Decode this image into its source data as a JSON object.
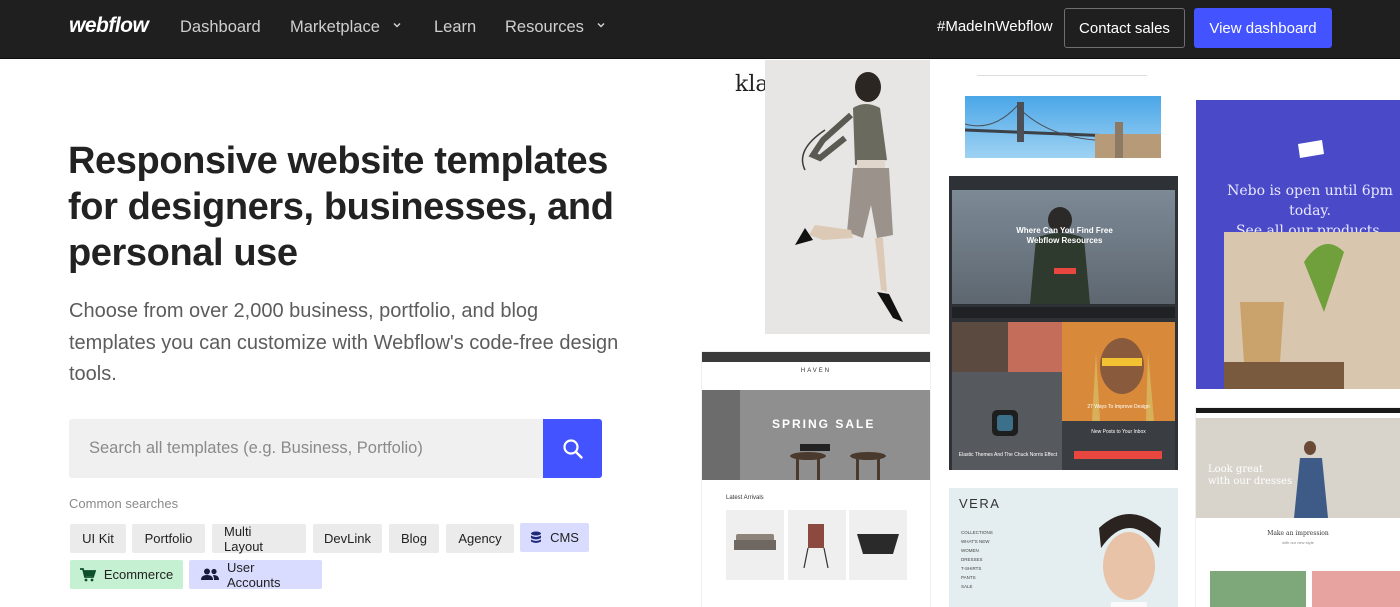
{
  "nav": {
    "logo": "webflow",
    "links": [
      {
        "label": "Dashboard",
        "has_dropdown": false
      },
      {
        "label": "Marketplace",
        "has_dropdown": true
      },
      {
        "label": "Learn",
        "has_dropdown": false
      },
      {
        "label": "Resources",
        "has_dropdown": true
      }
    ],
    "made_in": "#MadeInWebflow",
    "contact_label": "Contact sales",
    "dashboard_label": "View dashboard"
  },
  "hero": {
    "title": "Responsive website templates for designers, businesses, and personal use",
    "subtitle": "Choose from over 2,000 business, portfolio, and blog templates you can customize with Webflow's code-free design tools."
  },
  "search": {
    "placeholder": "Search all templates (e.g. Business, Portfolio)",
    "icon": "search-icon"
  },
  "common": {
    "label": "Common searches",
    "chips": [
      {
        "label": "UI Kit"
      },
      {
        "label": "Portfolio"
      },
      {
        "label": "Multi Layout"
      },
      {
        "label": "DevLink"
      },
      {
        "label": "Blog"
      },
      {
        "label": "Agency"
      },
      {
        "label": "CMS",
        "icon": "database-icon"
      },
      {
        "label": "Ecommerce",
        "icon": "cart-icon"
      },
      {
        "label": "User Accounts",
        "icon": "users-icon"
      }
    ]
  },
  "gallery": {
    "klaer": {
      "brand": "klær"
    },
    "haven": {
      "banner": "SPRING SALE",
      "brand": "HAVEN",
      "section": "Latest Arrivals"
    },
    "blog": {
      "headline": "Where Can You Find Free Webflow Resources",
      "card1": "Elastic Themes And The Chuck Norris Effect",
      "card2": "27 Ways To Improve Design",
      "card3": "New Posts to Your Inbox"
    },
    "vera": {
      "brand": "VERA",
      "menu": [
        "COLLECTIONS",
        "WHAT'S NEW",
        "WOMEN",
        "DRESSES",
        "T-SHIRTS",
        "PANTS",
        "SALE"
      ]
    },
    "nebo": {
      "line1": "Nebo is open until 6pm today.",
      "line2": "See all our products."
    },
    "dress": {
      "line1": "Look great",
      "line2": "with our dresses",
      "heading": "Make an impression",
      "sub": "with our new style"
    }
  },
  "colors": {
    "accent": "#4353ff",
    "nav_bg": "#1f1f1f",
    "nebo_bg": "#4a4ac9",
    "eco_chip": "#c5f0d2",
    "cms_chip": "#d9dcff"
  }
}
